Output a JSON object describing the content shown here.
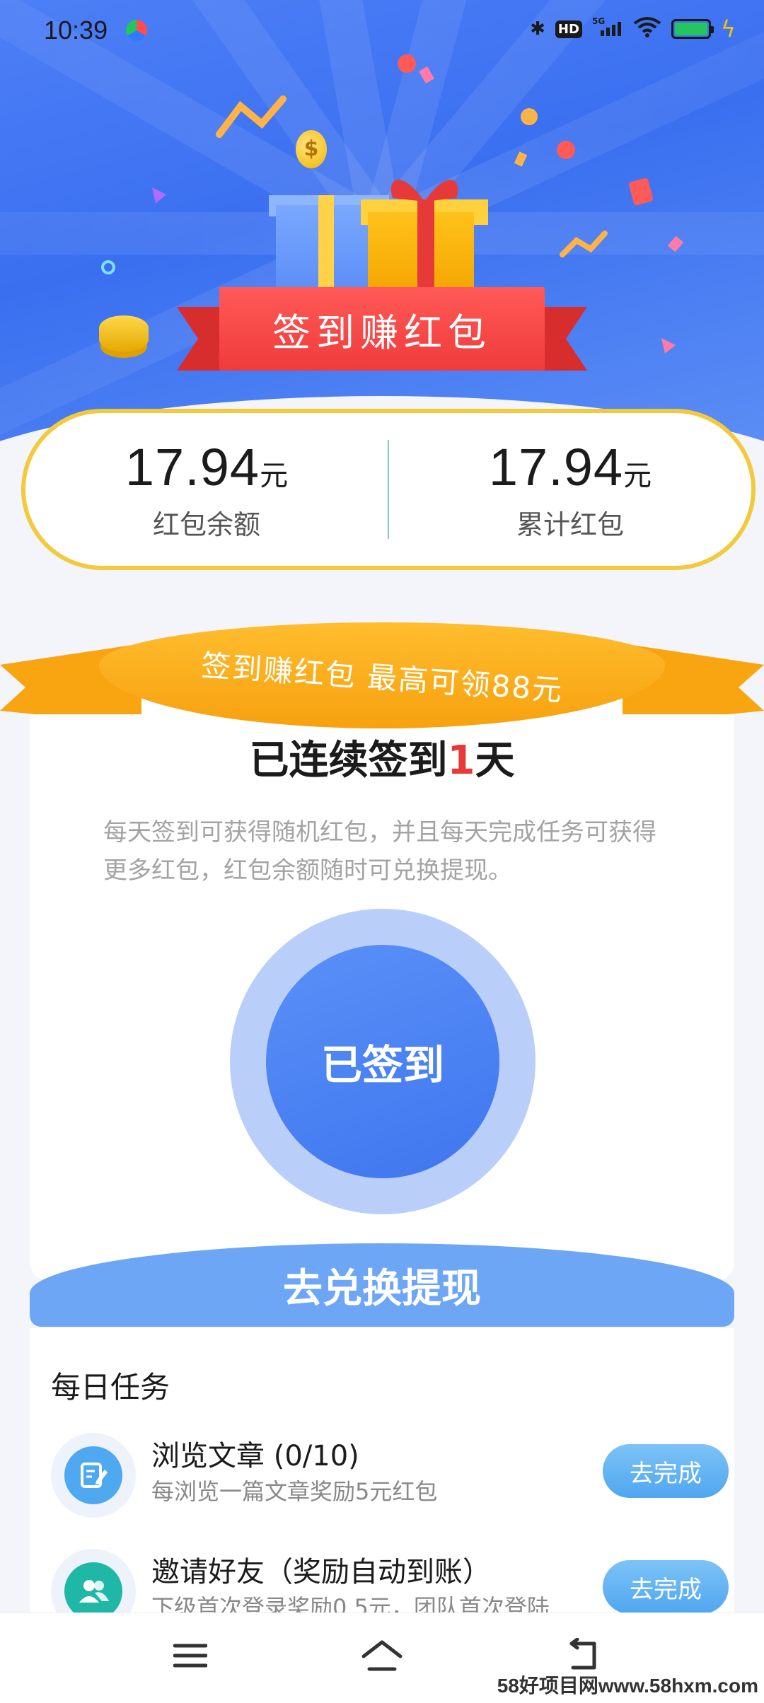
{
  "status_bar": {
    "time": "10:39",
    "hd_badge": "HD",
    "network": "5G"
  },
  "hero": {
    "banner_text": "签到赚红包",
    "coin_symbol": "$"
  },
  "balance": {
    "left": {
      "value": "17.94",
      "unit": "元",
      "label": "红包余额"
    },
    "right": {
      "value": "17.94",
      "unit": "元",
      "label": "累计红包"
    }
  },
  "signin": {
    "ribbon_text": "签到赚红包  最高可领88元",
    "streak_prefix": "已连续签到",
    "streak_days": "1",
    "streak_suffix": "天",
    "description": "每天签到可获得随机红包，并且每天完成任务可获得更多红包，红包余额随时可兑换提现。",
    "checkin_button": "已签到",
    "redeem_button": "去兑换提现"
  },
  "tasks": {
    "title": "每日任务",
    "items": [
      {
        "title": "浏览文章 (0/10)",
        "subtitle": "每浏览一篇文章奖励5元红包",
        "button": "去完成",
        "icon": "edit-document-icon",
        "icon_color": "#4fa9f0"
      },
      {
        "title": "邀请好友（奖励自动到账）",
        "subtitle": "下级首次登录奖励0.5元，团队首次登陆",
        "button": "去完成",
        "icon": "users-icon",
        "icon_color": "#1fb7a6"
      }
    ]
  },
  "watermark": "58好项目网www.58hxm.com",
  "colors": {
    "hero_blue": "#3a6ff0",
    "banner_red": "#ef3b3b",
    "ribbon_orange": "#f7a10f",
    "card_border_gold": "#f3c93d",
    "checkin_blue": "#3f76ef",
    "accent_red": "#e63a3a"
  }
}
